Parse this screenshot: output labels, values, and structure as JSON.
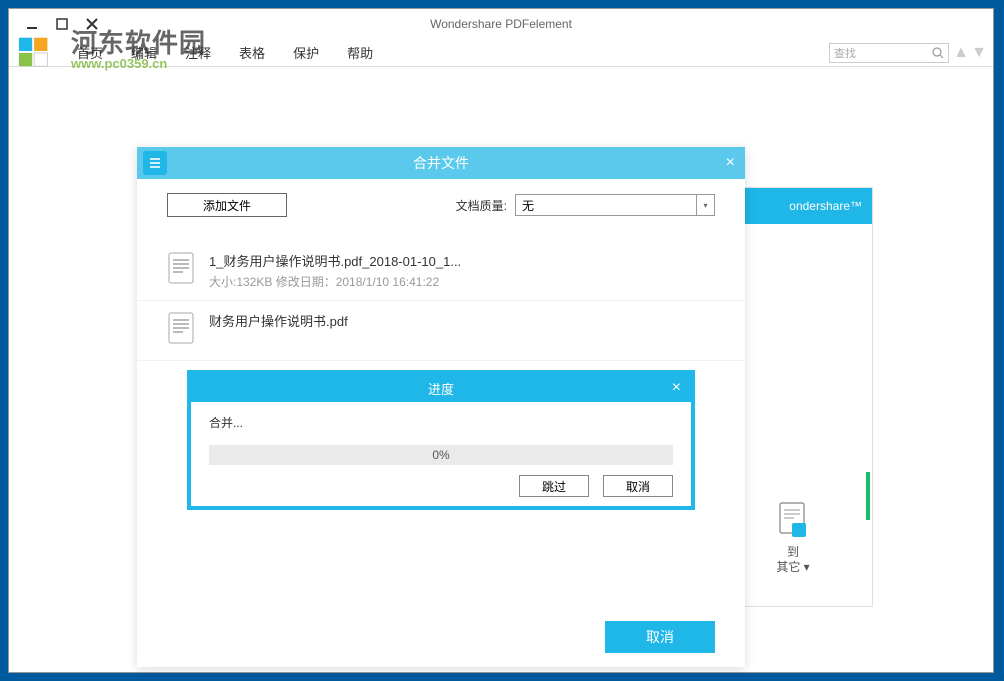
{
  "window": {
    "title": "Wondershare PDFelement"
  },
  "menu": {
    "items": [
      "首页",
      "编辑",
      "注释",
      "表格",
      "保护",
      "帮助"
    ]
  },
  "search": {
    "placeholder": "查找"
  },
  "watermark": {
    "main": "河东软件园",
    "sub": "www.pc0359.cn"
  },
  "bg_panel": {
    "brand": "ondershare™",
    "side_label": "到\n其它 ▾"
  },
  "merge": {
    "title": "合并文件",
    "add_file": "添加文件",
    "quality_label": "文档质量:",
    "quality_value": "无",
    "cancel": "取消",
    "files": [
      {
        "name": "1_财务用户操作说明书.pdf_2018-01-10_1...",
        "meta": "大小:132KB 修改日期：2018/1/10 16:41:22"
      },
      {
        "name": "财务用户操作说明书.pdf",
        "meta": ""
      }
    ]
  },
  "progress": {
    "title": "进度",
    "label": "合并...",
    "percent": "0%",
    "skip": "跳过",
    "cancel": "取消"
  }
}
